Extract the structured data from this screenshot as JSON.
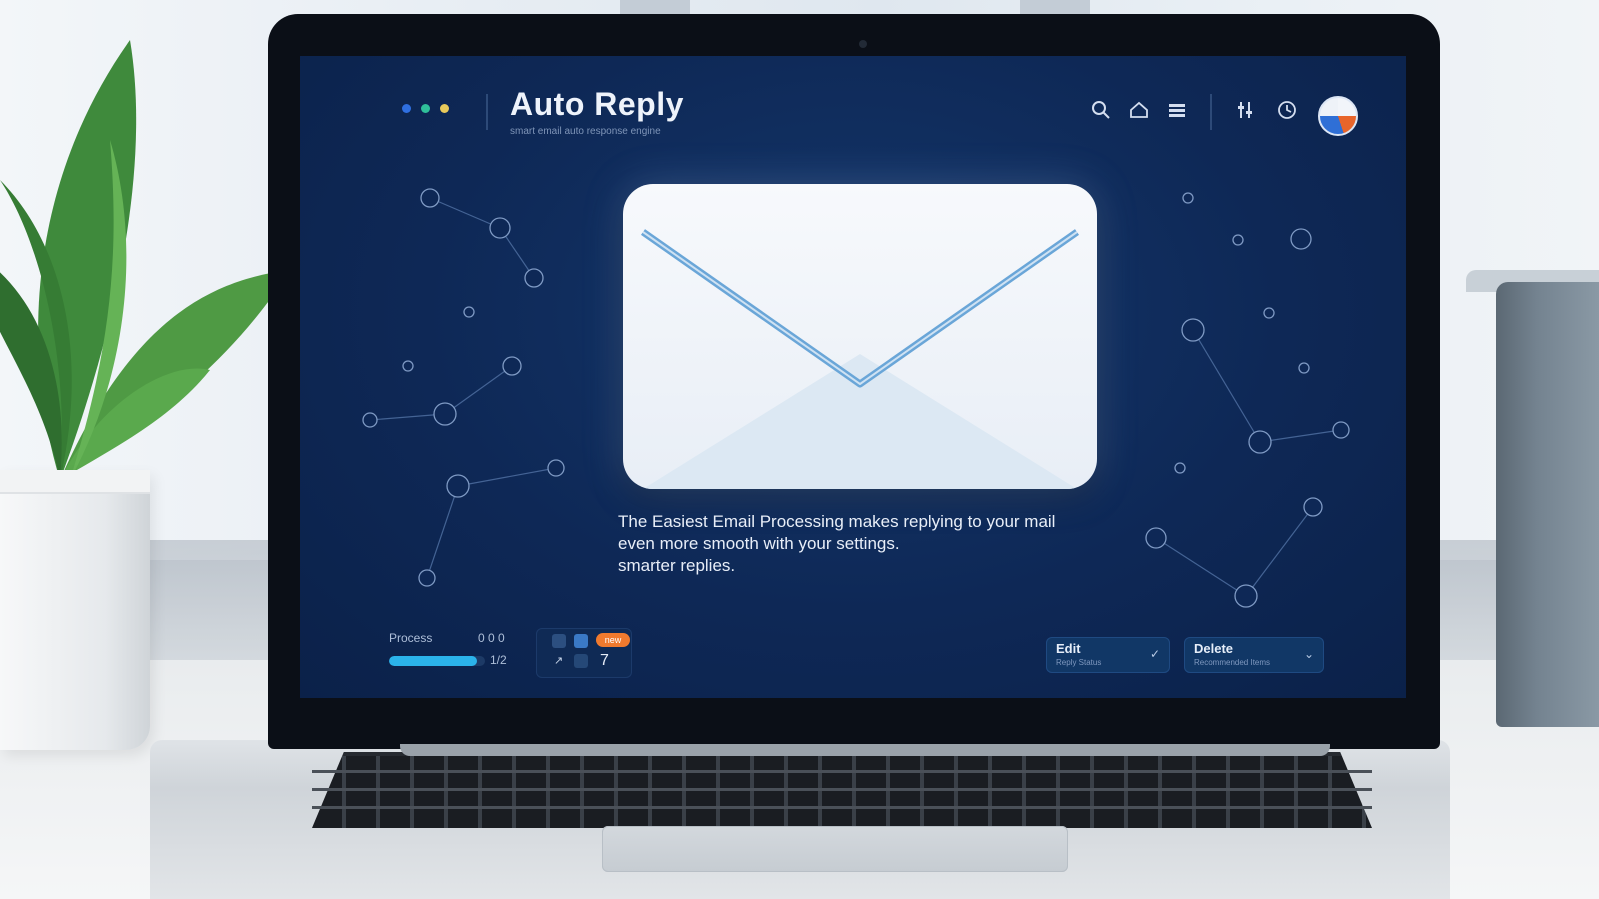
{
  "app": {
    "title": "Auto Reply",
    "subtitle": "smart email auto response engine"
  },
  "window_controls": {
    "colors": [
      "#2f6fe0",
      "#2fbf9a",
      "#e8c95b"
    ]
  },
  "header_icons": [
    "search-icon",
    "home-icon",
    "menu-icon",
    "filter-icon",
    "clock-icon"
  ],
  "description": {
    "lines": [
      "The Easiest Email Processing makes replying to your mail",
      "even more smooth with your settings.",
      "smarter replies."
    ]
  },
  "status": {
    "label": "Process",
    "value": "0 0 0",
    "progress_fraction": 0.92,
    "count": "1/2"
  },
  "mini_panel": {
    "badge": "new",
    "number": "7",
    "arrow": "↗"
  },
  "dropdowns": [
    {
      "title": "Edit",
      "subtitle": "Reply Status"
    },
    {
      "title": "Delete",
      "subtitle": "Recommended Items"
    }
  ],
  "colors": {
    "screen_bg": "#0e2856",
    "accent_progress": "#2bb3ea",
    "badge": "#f07a2e",
    "envelope_fold": "#6aa6d8"
  }
}
